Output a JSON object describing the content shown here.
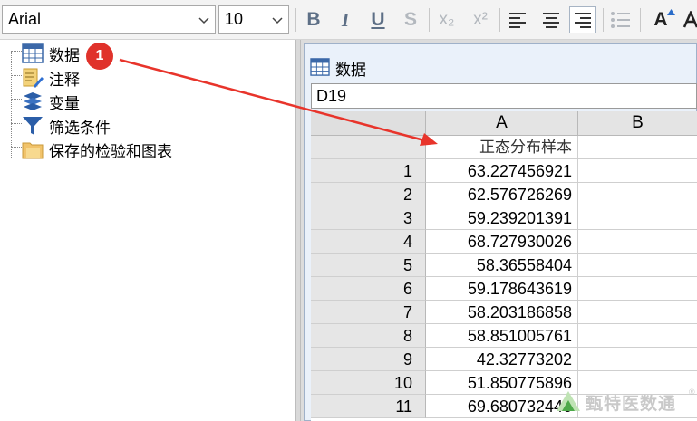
{
  "toolbar": {
    "font_family": "Arial",
    "font_size": "10",
    "bold": "B",
    "italic": "I",
    "underline": "U",
    "strikethrough": "S",
    "subscript": "x₂",
    "superscript": "x²",
    "increase_font": "A"
  },
  "tree": {
    "items": [
      {
        "label": "数据",
        "icon": "table-icon"
      },
      {
        "label": "注释",
        "icon": "notes-icon"
      },
      {
        "label": "变量",
        "icon": "layers-icon"
      },
      {
        "label": "筛选条件",
        "icon": "filter-icon"
      },
      {
        "label": "保存的检验和图表",
        "icon": "folder-icon"
      }
    ]
  },
  "annotation": {
    "badge": "1",
    "color": "#e0322b"
  },
  "data_window": {
    "title": "数据",
    "cell_ref": "D19",
    "columns": [
      "A",
      "B"
    ],
    "header_row": {
      "A": "正态分布样本"
    },
    "rows": [
      {
        "num": "1",
        "A": "63.227456921"
      },
      {
        "num": "2",
        "A": "62.576726269"
      },
      {
        "num": "3",
        "A": "59.239201391"
      },
      {
        "num": "4",
        "A": "68.727930026"
      },
      {
        "num": "5",
        "A": "58.36558404"
      },
      {
        "num": "6",
        "A": "59.178643619"
      },
      {
        "num": "7",
        "A": "58.203186858"
      },
      {
        "num": "8",
        "A": "58.851005761"
      },
      {
        "num": "9",
        "A": "42.32773202"
      },
      {
        "num": "10",
        "A": "51.850775896"
      },
      {
        "num": "11",
        "A": "69.680732446"
      }
    ]
  },
  "watermark": {
    "text": "甄特医数通",
    "reg": "®"
  }
}
